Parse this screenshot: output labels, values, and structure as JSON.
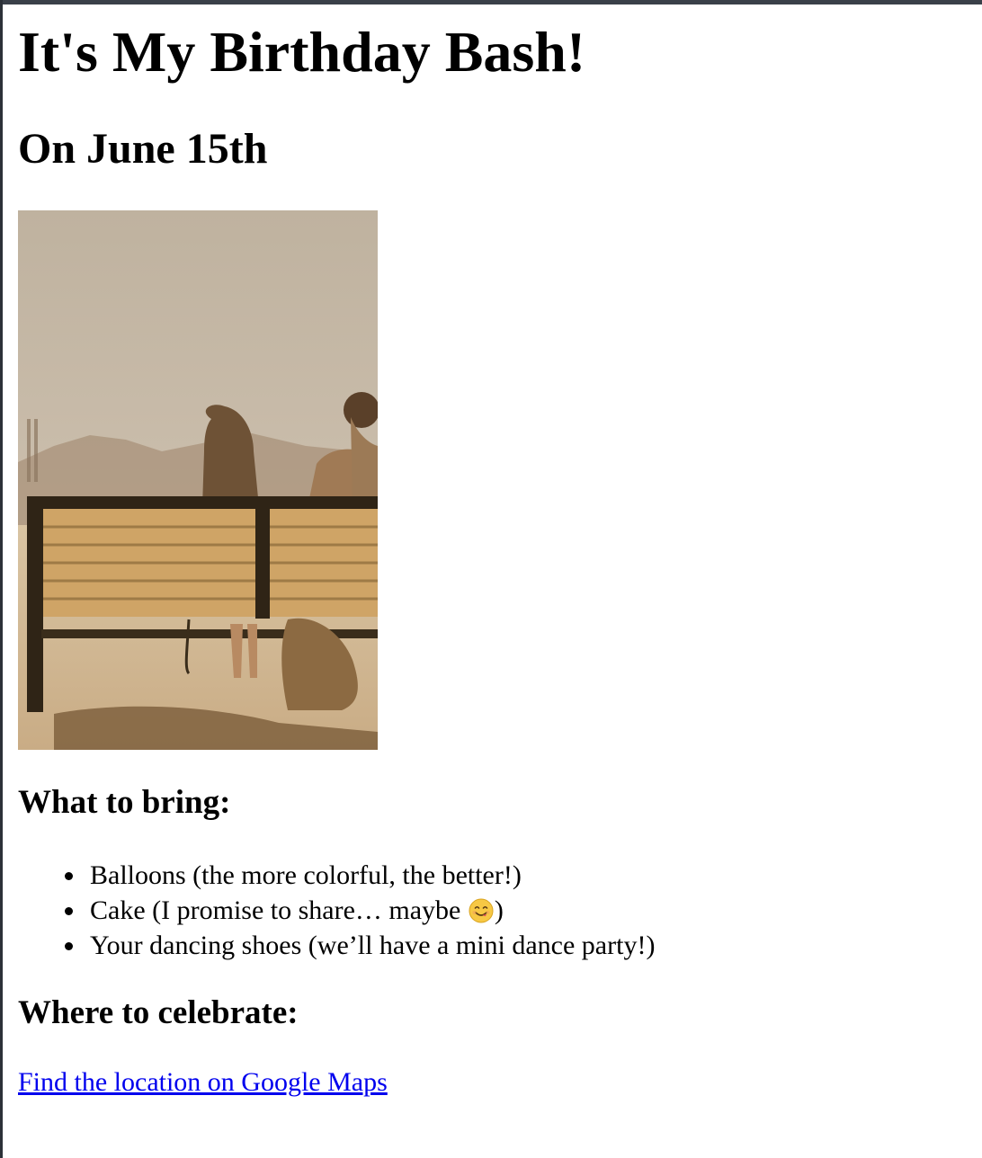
{
  "page": {
    "title": "It's My Birthday Bash!",
    "subtitle": "On June 15th"
  },
  "photo": {
    "description_icon": "photo-couple-on-bench"
  },
  "bring": {
    "heading": "What to bring:",
    "items": [
      {
        "text": "Balloons (the more colorful, the better!)"
      },
      {
        "text_before": "Cake (I promise to share… maybe ",
        "emoji": "smiling-face-icon",
        "text_after": ")"
      },
      {
        "text": "Your dancing shoes (we’ll have a mini dance party!)"
      }
    ]
  },
  "where": {
    "heading": "Where to celebrate:",
    "link_text": "Find the location on Google Maps"
  },
  "colors": {
    "link": "#0000ee",
    "top_bar": "#3a4049"
  }
}
